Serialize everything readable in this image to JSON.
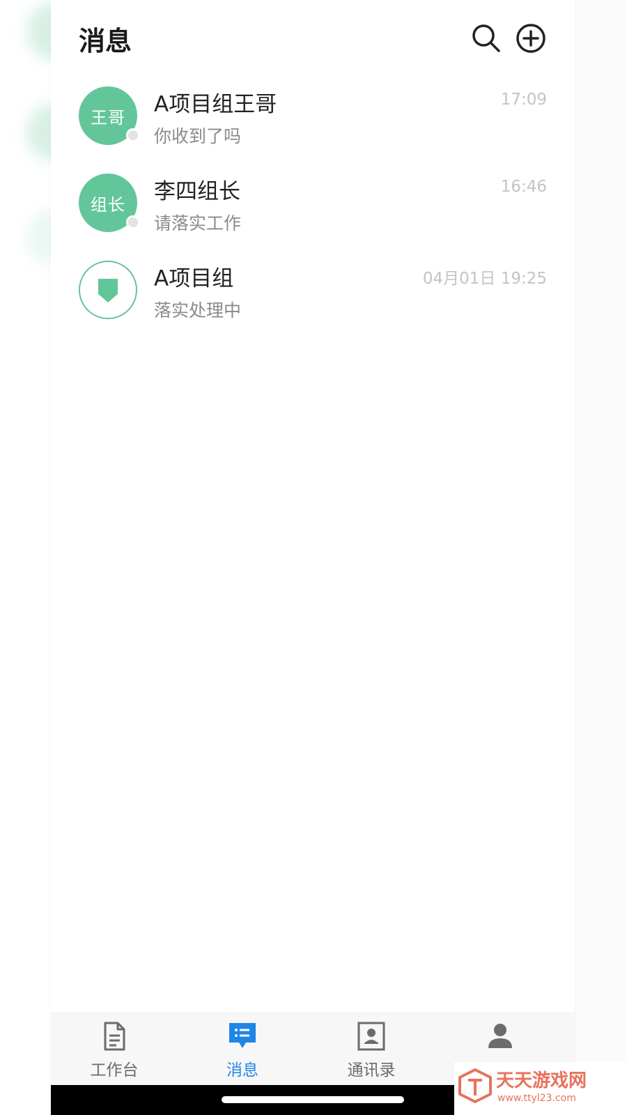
{
  "header": {
    "title": "消息",
    "search_icon": "search-icon",
    "add_icon": "add-circle-icon"
  },
  "conversations": [
    {
      "avatar_text": "王哥",
      "name": "A项目组王哥",
      "preview": "你收到了吗",
      "time": "17:09",
      "avatar_color": "#63c69a"
    },
    {
      "avatar_text": "组长",
      "name": "李四组长",
      "preview": "请落实工作",
      "time": "16:46",
      "avatar_color": "#63c69a"
    },
    {
      "avatar_icon": "group-shield-icon",
      "name": "A项目组",
      "preview": "落实处理中",
      "time": "04月01日 19:25",
      "avatar_color": "#63c69a"
    }
  ],
  "tabbar": {
    "tabs": [
      {
        "label": "工作台",
        "icon": "document-icon",
        "active": false
      },
      {
        "label": "消息",
        "icon": "message-icon",
        "active": true
      },
      {
        "label": "通讯录",
        "icon": "contacts-icon",
        "active": false
      },
      {
        "label": "",
        "icon": "person-icon",
        "active": false
      }
    ],
    "active_color": "#1f86e6",
    "inactive_color": "#6b6b6b"
  },
  "watermark": {
    "name": "天天游戏网",
    "url": "www.ttyl23.com"
  }
}
